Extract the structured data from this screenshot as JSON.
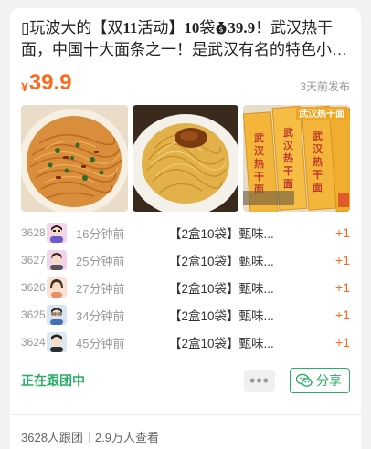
{
  "post": {
    "title_icon": "square-glyph",
    "title_prefix": "玩波大的【双",
    "title_eleven": "11",
    "title_mid": "活动】",
    "title_ten": "10",
    "title_bags": "袋",
    "title_price_inline": "39.9",
    "title_rest": "！武汉热干面，中国十大面条之一！是武汉有名的特色小吃，红油、芝麻酱、香菜",
    "price_currency": "¥",
    "price": "39.9",
    "posted": "3天前发布"
  },
  "images": [
    {
      "name": "noodles-bowl-image"
    },
    {
      "name": "noodles-plate-image"
    },
    {
      "name": "package-image",
      "text": "武汉热干面"
    }
  ],
  "orders": [
    {
      "no": "3628",
      "time": "16分钟前",
      "item": "【2盒10袋】甄味...",
      "qty": "+1"
    },
    {
      "no": "3627",
      "time": "25分钟前",
      "item": "【2盒10袋】甄味...",
      "qty": "+1"
    },
    {
      "no": "3626",
      "time": "27分钟前",
      "item": "【2盒10袋】甄味...",
      "qty": "+1"
    },
    {
      "no": "3625",
      "time": "34分钟前",
      "item": "【2盒10袋】甄味...",
      "qty": "+1"
    },
    {
      "no": "3624",
      "time": "45分钟前",
      "item": "【2盒10袋】甄味...",
      "qty": "+1"
    }
  ],
  "actions": {
    "status": "正在跟团中",
    "more": "•••",
    "share": "分享"
  },
  "footer": {
    "followers": "3628人跟团",
    "views": "2.9万人查看"
  },
  "colors": {
    "accent": "#ff6a1a",
    "green": "#2aae67"
  }
}
